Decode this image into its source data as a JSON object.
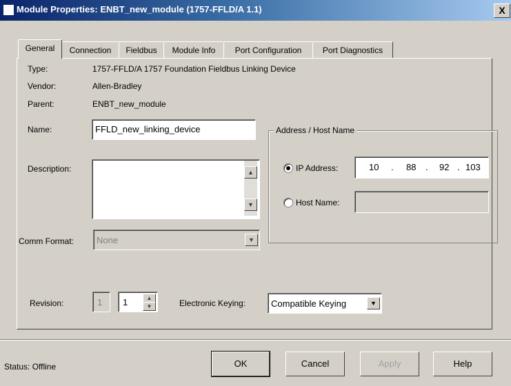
{
  "window": {
    "title": "Module Properties: ENBT_new_module (1757-FFLD/A 1.1)",
    "close_glyph": "X"
  },
  "tabs": [
    {
      "label": "General"
    },
    {
      "label": "Connection"
    },
    {
      "label": "Fieldbus"
    },
    {
      "label": "Module Info"
    },
    {
      "label": "Port Configuration"
    },
    {
      "label": "Port Diagnostics"
    }
  ],
  "general": {
    "type_label": "Type:",
    "type_value": "1757-FFLD/A 1757 Foundation Fieldbus Linking Device",
    "vendor_label": "Vendor:",
    "vendor_value": "Allen-Bradley",
    "parent_label": "Parent:",
    "parent_value": "ENBT_new_module",
    "name_label": "Name:",
    "name_value": "FFLD_new_linking_device",
    "description_label": "Description:",
    "description_value": "",
    "comm_format_label": "Comm Format:",
    "comm_format_value": "None",
    "revision_label": "Revision:",
    "revision_major": "1",
    "revision_minor": "1",
    "keying_label": "Electronic Keying:",
    "keying_value": "Compatible Keying"
  },
  "address": {
    "group_title": "Address / Host Name",
    "ip_label": "IP Address:",
    "ip_octets": [
      "10",
      "88",
      "92",
      "103"
    ],
    "ip_selected": true,
    "host_label": "Host Name:",
    "host_value": ""
  },
  "footer": {
    "status_text": "Status:  Offline",
    "ok_label": "OK",
    "cancel_label": "Cancel",
    "apply_label": "Apply",
    "help_label": "Help"
  },
  "icons": {
    "app": "module-properties-icon",
    "up_arrow": "▲",
    "down_arrow": "▼"
  }
}
